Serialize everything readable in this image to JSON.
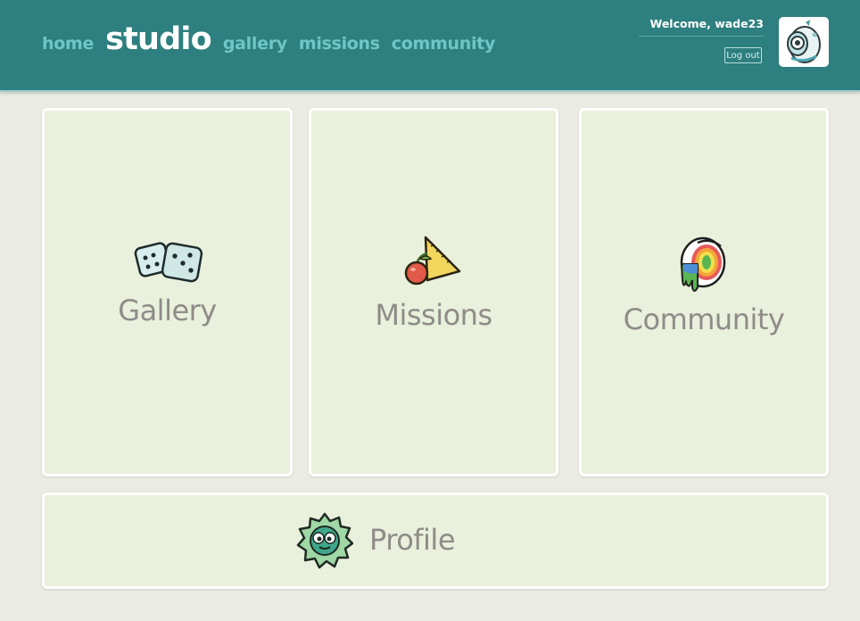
{
  "nav": {
    "home": "home",
    "studio": "studio",
    "gallery": "gallery",
    "missions": "missions",
    "community": "community"
  },
  "user": {
    "welcome": "Welcome, wade23",
    "logout": "Log out"
  },
  "cards": {
    "gallery": "Gallery",
    "missions": "Missions",
    "community": "Community",
    "profile": "Profile"
  },
  "icons": {
    "gallery": "dice-icon",
    "missions": "cherry-and-ruler-icon",
    "community": "rainbow-paint-bucket-icon",
    "profile": "green-monster-icon",
    "avatar": "robot-avatar"
  },
  "colors": {
    "header": "#2e7f7f",
    "nav_link": "#6ec6c6",
    "card_bg": "#e9f0dc",
    "page_bg": "#eaece3",
    "card_text": "#8f8c88"
  }
}
